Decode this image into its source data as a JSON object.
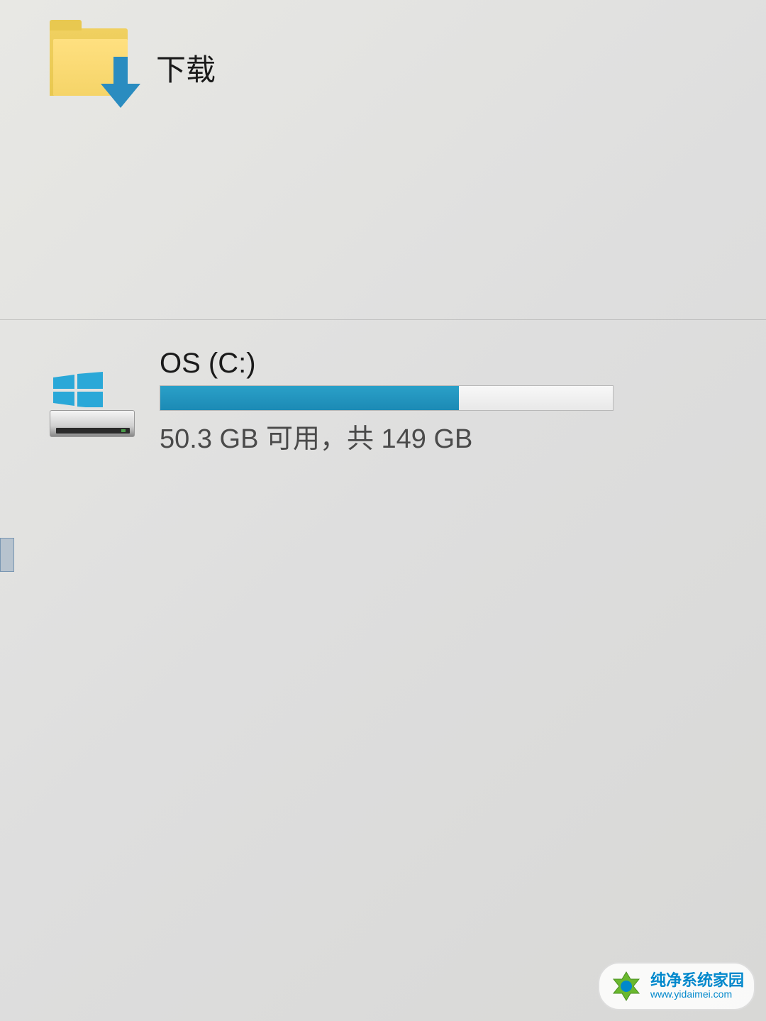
{
  "downloads": {
    "label": "下载"
  },
  "drive": {
    "title": "OS (C:)",
    "free_gb": 50.3,
    "total_gb": 149,
    "stats_text": "50.3 GB 可用，共 149 GB",
    "used_percent": 66,
    "fill_color": "#1e96c0",
    "track_color": "#ebebeb"
  },
  "watermark": {
    "title": "纯净系统家园",
    "url": "www.yidaimei.com"
  }
}
